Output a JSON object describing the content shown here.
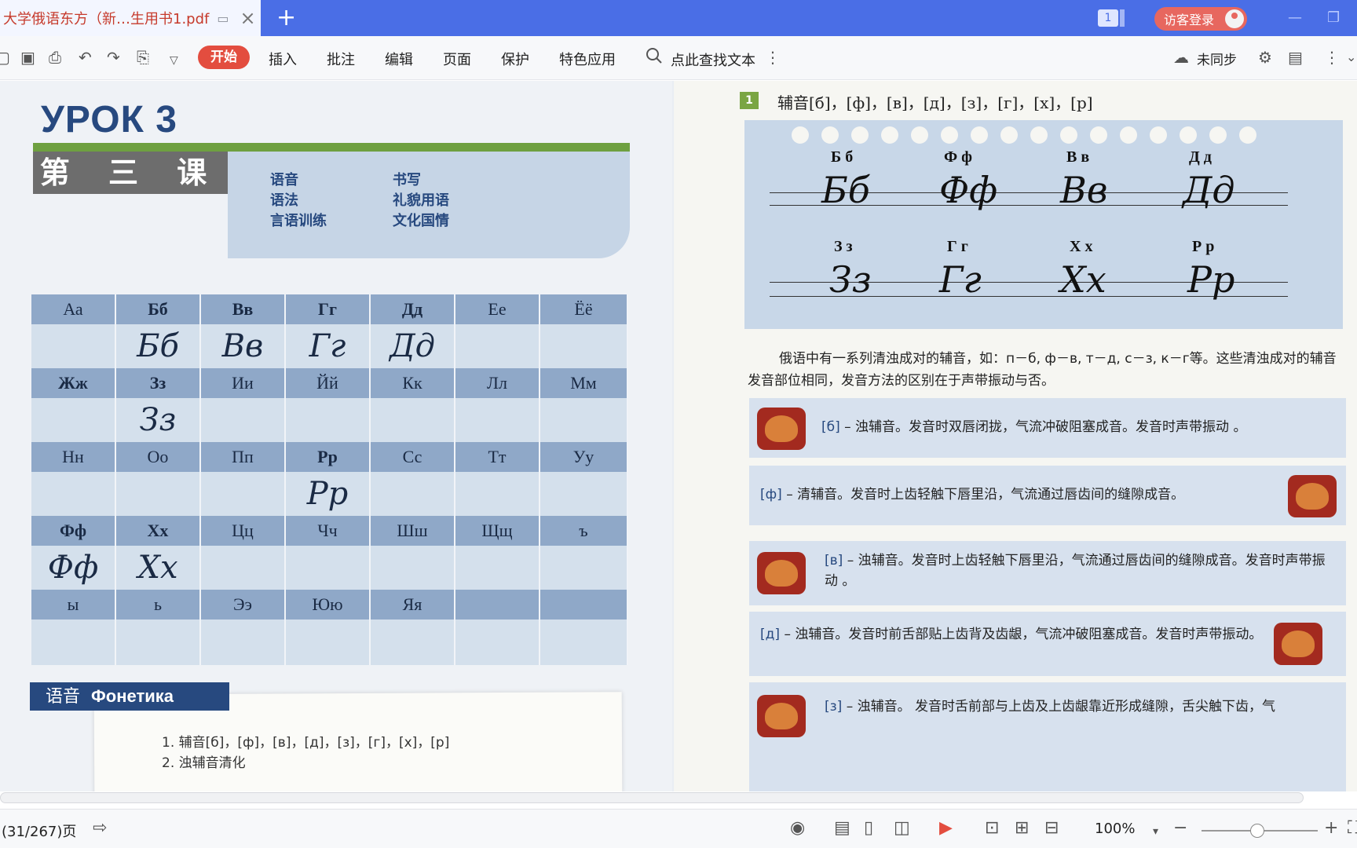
{
  "titlebar": {
    "doc_tab": "大学俄语东方（新…生用书1.pdf",
    "new_tab": "+",
    "badge": "1",
    "login": "访客登录"
  },
  "toolbar": {
    "menus": [
      "开始",
      "插入",
      "批注",
      "编辑",
      "页面",
      "保护",
      "特色应用"
    ],
    "search": "点此查找文本",
    "sync": "未同步"
  },
  "left_page": {
    "heading": "УРОК 3",
    "subheading": "第 三 课",
    "contents": [
      "语音",
      "书写",
      "语法",
      "礼貌用语",
      "言语训练",
      "文化国情"
    ],
    "alphabet": [
      {
        "hdr": [
          "Аа",
          "Бб",
          "Вв",
          "Гг",
          "Дд",
          "Ее",
          "Ёё"
        ],
        "cursive": [
          "",
          "Бб",
          "Вв",
          "Гг",
          "Дд",
          "",
          ""
        ]
      },
      {
        "hdr": [
          "Жж",
          "Зз",
          "Ии",
          "Йй",
          "Кк",
          "Лл",
          "Мм"
        ],
        "cursive": [
          "",
          "Зз",
          "",
          "",
          "",
          "",
          ""
        ]
      },
      {
        "hdr": [
          "Нн",
          "Оо",
          "Пп",
          "Рр",
          "Сс",
          "Тт",
          "Уу"
        ],
        "cursive": [
          "",
          "",
          "",
          "Рр",
          "",
          "",
          ""
        ]
      },
      {
        "hdr": [
          "Фф",
          "Хх",
          "Цц",
          "Чч",
          "Шш",
          "Щщ",
          "ъ"
        ],
        "cursive": [
          "Фф",
          "Хх",
          "",
          "",
          "",
          "",
          ""
        ]
      },
      {
        "hdr": [
          "ы",
          "ь",
          "Ээ",
          "Юю",
          "Яя",
          "",
          ""
        ],
        "cursive": [
          "",
          "",
          "",
          "",
          "",
          "",
          ""
        ]
      }
    ],
    "phonetics_label_cn": "语音",
    "phonetics_label_ru": "Фонетика",
    "phonetics_items": [
      "1. 辅音[б]，[ф]，[в]，[д]，[з]，[г]，[х]，[р]",
      "2. 浊辅音清化"
    ]
  },
  "right_page": {
    "section_num": "1",
    "section_title": "辅音[б]，[ф]，[в]，[д]，[з]，[г]，[х]，[р]",
    "print_letters_row1": [
      "Б б",
      "Ф ф",
      "В в",
      "Д д"
    ],
    "print_letters_row2": [
      "З з",
      "Г г",
      "Х х",
      "Р р"
    ],
    "cursive_row1": [
      "Бб",
      "Фф",
      "Вв",
      "Дд"
    ],
    "cursive_row2": [
      "Зз",
      "Гг",
      "Хх",
      "Рр"
    ],
    "paragraph": "俄语中有一系列清浊成对的辅音，如：п－б, ф－в, т－д, с－з, к－г等。这些清浊成对的辅音发音部位相同，发音方法的区别在于声带振动与否。",
    "explanations": [
      {
        "key": "[б]",
        "text": "– 浊辅音。发音时双唇闭拢，气流冲破阻塞成音。发音时声带振动 。"
      },
      {
        "key": "[ф]",
        "text": "– 清辅音。发音时上齿轻触下唇里沿，气流通过唇齿间的缝隙成音。"
      },
      {
        "key": "[в]",
        "text": "– 浊辅音。发音时上齿轻触下唇里沿，气流通过唇齿间的缝隙成音。发音时声带振动 。"
      },
      {
        "key": "[д]",
        "text": "– 浊辅音。发音时前舌部贴上齿背及齿龈，气流冲破阻塞成音。发音时声带振动。"
      },
      {
        "key": "[з]",
        "text": "– 浊辅音。 发音时舌前部与上齿及上齿龈靠近形成缝隙，舌尖触下齿，气"
      }
    ]
  },
  "statusbar": {
    "page": "(31/267)页",
    "zoom": "100%"
  }
}
